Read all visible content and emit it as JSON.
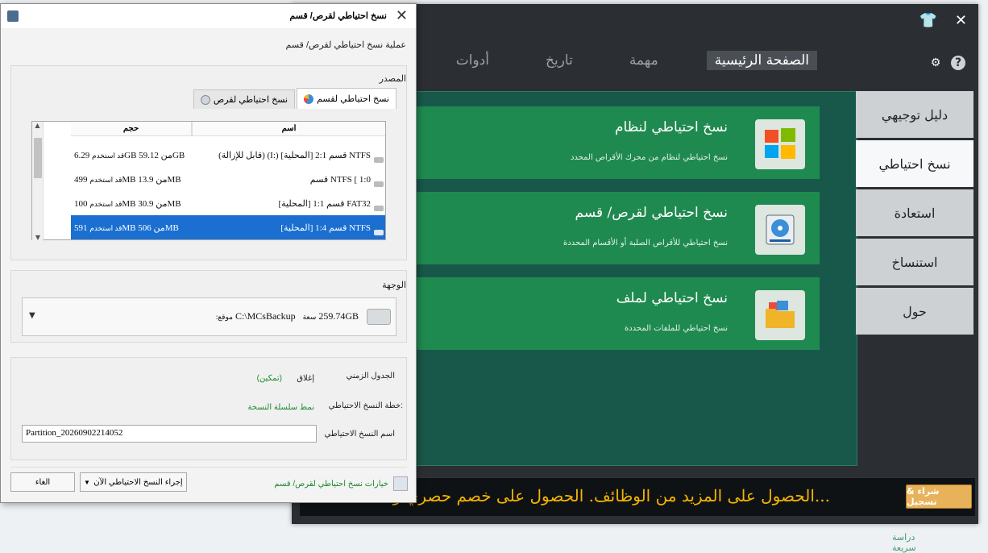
{
  "app": {
    "nav": {
      "home": "الصفحة الرئيسية",
      "task": "مهمة",
      "history": "تاريخ",
      "tools": "أدوات"
    },
    "cards": [
      {
        "title": "نسخ احتياطي لنظام",
        "desc": "نسخ احتياطي لنظام من محرك الأقراص المحدد"
      },
      {
        "title": "نسخ احتياطي لقرص/ قسم",
        "desc": "نسخ احتياطي للأقراص الصلبة أو الأقسام المحددة"
      },
      {
        "title": "نسخ احتياطي لملف",
        "desc": "نسخ احتياطي للملفات المحددة"
      }
    ],
    "quick": "دراسة سريعة",
    "side": [
      "دليل توجيهي",
      "نسخ احتياطي",
      "استعادة",
      "استنساخ",
      "حول"
    ],
    "promo_text": "الحصول على المزيد من الوظائف. الحصول على خصم حصري و...",
    "promo_button": "شراء & تسجيل"
  },
  "dialog": {
    "title": "نسخ احتياطي لقرص/ قسم",
    "subtitle": "عملية نسخ احتياطي لقرص/ قسم",
    "source_label": "المصدر",
    "tab_partition": "نسخ احتياطي لقسم",
    "tab_disk": "نسخ احتياطي لقرص",
    "col_name": "اسم",
    "col_size": "حجم",
    "rows": [
      {
        "name": "(قابل للإزالة) (I:) قسم 2:1 [المحلية] NTFS",
        "used": "قد استخدم",
        "size": "6.29GB من 59.12GB"
      },
      {
        "name": "قسم NTFS [ 1:0",
        "used": "قد استخدم",
        "size": "499MB من 13.9MB"
      },
      {
        "name": "قسم 1:1 [المحلية] FAT32",
        "used": "قد استخدم",
        "size": "100MB من 30.9MB"
      },
      {
        "name": "قسم 1:4 [المحلية] NTFS",
        "used": "قد استخدم",
        "size": "591MB من 506MB"
      }
    ],
    "dest_label": "الوجهة",
    "dest_size": "259.74GB",
    "dest_cap": "سعة",
    "dest_loc_label": "موقع:",
    "dest_path": "C:\\MCsBackup",
    "schedule_label": "الجدول الزمني",
    "schedule_off": "إغلاق",
    "schedule_enable": "(تمكين)",
    "plan_label": "خطة النسخ الاحتياطي:",
    "plan_value": "نمط سلسلة النسخة",
    "name_label": "اسم النسخ الاحتياطي",
    "name_value": "Partition_20260902214052",
    "options": "خيارات نسخ احتياطي لقرص/ قسم",
    "run_button": "إجراء النسخ الاحتياطي الآن",
    "cancel_button": "الغاء"
  }
}
